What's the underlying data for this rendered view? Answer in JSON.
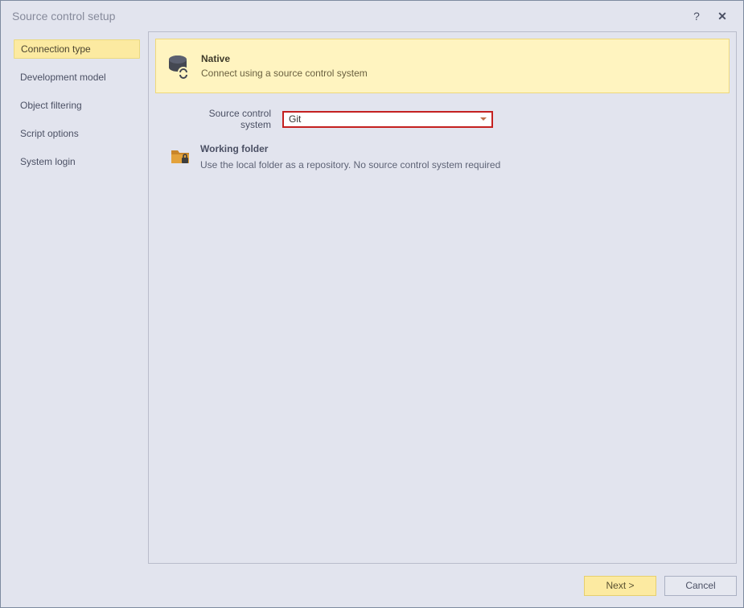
{
  "window": {
    "title": "Source control setup",
    "help_glyph": "?",
    "close_glyph": "✕"
  },
  "sidebar": {
    "items": [
      {
        "label": "Connection type",
        "selected": true
      },
      {
        "label": "Development model",
        "selected": false
      },
      {
        "label": "Object filtering",
        "selected": false
      },
      {
        "label": "Script options",
        "selected": false
      },
      {
        "label": "System login",
        "selected": false
      }
    ]
  },
  "main": {
    "banner": {
      "icon": "database-link-icon",
      "title": "Native",
      "subtitle": "Connect using a source control system"
    },
    "source_system": {
      "label": "Source control system",
      "value": "Git"
    },
    "working_folder": {
      "icon": "folder-lock-icon",
      "title": "Working folder",
      "subtitle": "Use the local folder as a repository. No source control system required"
    }
  },
  "footer": {
    "next_label": "Next >",
    "cancel_label": "Cancel"
  }
}
